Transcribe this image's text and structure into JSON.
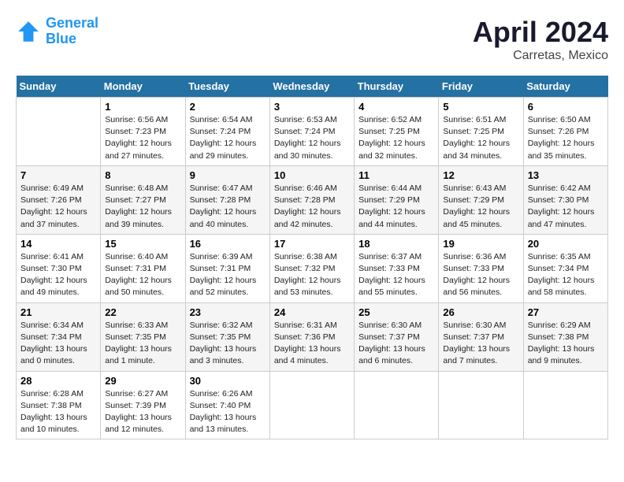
{
  "header": {
    "logo_line1": "General",
    "logo_line2": "Blue",
    "title": "April 2024",
    "subtitle": "Carretas, Mexico"
  },
  "days_of_week": [
    "Sunday",
    "Monday",
    "Tuesday",
    "Wednesday",
    "Thursday",
    "Friday",
    "Saturday"
  ],
  "weeks": [
    [
      {
        "num": "",
        "info": ""
      },
      {
        "num": "1",
        "info": "Sunrise: 6:56 AM\nSunset: 7:23 PM\nDaylight: 12 hours\nand 27 minutes."
      },
      {
        "num": "2",
        "info": "Sunrise: 6:54 AM\nSunset: 7:24 PM\nDaylight: 12 hours\nand 29 minutes."
      },
      {
        "num": "3",
        "info": "Sunrise: 6:53 AM\nSunset: 7:24 PM\nDaylight: 12 hours\nand 30 minutes."
      },
      {
        "num": "4",
        "info": "Sunrise: 6:52 AM\nSunset: 7:25 PM\nDaylight: 12 hours\nand 32 minutes."
      },
      {
        "num": "5",
        "info": "Sunrise: 6:51 AM\nSunset: 7:25 PM\nDaylight: 12 hours\nand 34 minutes."
      },
      {
        "num": "6",
        "info": "Sunrise: 6:50 AM\nSunset: 7:26 PM\nDaylight: 12 hours\nand 35 minutes."
      }
    ],
    [
      {
        "num": "7",
        "info": "Sunrise: 6:49 AM\nSunset: 7:26 PM\nDaylight: 12 hours\nand 37 minutes."
      },
      {
        "num": "8",
        "info": "Sunrise: 6:48 AM\nSunset: 7:27 PM\nDaylight: 12 hours\nand 39 minutes."
      },
      {
        "num": "9",
        "info": "Sunrise: 6:47 AM\nSunset: 7:28 PM\nDaylight: 12 hours\nand 40 minutes."
      },
      {
        "num": "10",
        "info": "Sunrise: 6:46 AM\nSunset: 7:28 PM\nDaylight: 12 hours\nand 42 minutes."
      },
      {
        "num": "11",
        "info": "Sunrise: 6:44 AM\nSunset: 7:29 PM\nDaylight: 12 hours\nand 44 minutes."
      },
      {
        "num": "12",
        "info": "Sunrise: 6:43 AM\nSunset: 7:29 PM\nDaylight: 12 hours\nand 45 minutes."
      },
      {
        "num": "13",
        "info": "Sunrise: 6:42 AM\nSunset: 7:30 PM\nDaylight: 12 hours\nand 47 minutes."
      }
    ],
    [
      {
        "num": "14",
        "info": "Sunrise: 6:41 AM\nSunset: 7:30 PM\nDaylight: 12 hours\nand 49 minutes."
      },
      {
        "num": "15",
        "info": "Sunrise: 6:40 AM\nSunset: 7:31 PM\nDaylight: 12 hours\nand 50 minutes."
      },
      {
        "num": "16",
        "info": "Sunrise: 6:39 AM\nSunset: 7:31 PM\nDaylight: 12 hours\nand 52 minutes."
      },
      {
        "num": "17",
        "info": "Sunrise: 6:38 AM\nSunset: 7:32 PM\nDaylight: 12 hours\nand 53 minutes."
      },
      {
        "num": "18",
        "info": "Sunrise: 6:37 AM\nSunset: 7:33 PM\nDaylight: 12 hours\nand 55 minutes."
      },
      {
        "num": "19",
        "info": "Sunrise: 6:36 AM\nSunset: 7:33 PM\nDaylight: 12 hours\nand 56 minutes."
      },
      {
        "num": "20",
        "info": "Sunrise: 6:35 AM\nSunset: 7:34 PM\nDaylight: 12 hours\nand 58 minutes."
      }
    ],
    [
      {
        "num": "21",
        "info": "Sunrise: 6:34 AM\nSunset: 7:34 PM\nDaylight: 13 hours\nand 0 minutes."
      },
      {
        "num": "22",
        "info": "Sunrise: 6:33 AM\nSunset: 7:35 PM\nDaylight: 13 hours\nand 1 minute."
      },
      {
        "num": "23",
        "info": "Sunrise: 6:32 AM\nSunset: 7:35 PM\nDaylight: 13 hours\nand 3 minutes."
      },
      {
        "num": "24",
        "info": "Sunrise: 6:31 AM\nSunset: 7:36 PM\nDaylight: 13 hours\nand 4 minutes."
      },
      {
        "num": "25",
        "info": "Sunrise: 6:30 AM\nSunset: 7:37 PM\nDaylight: 13 hours\nand 6 minutes."
      },
      {
        "num": "26",
        "info": "Sunrise: 6:30 AM\nSunset: 7:37 PM\nDaylight: 13 hours\nand 7 minutes."
      },
      {
        "num": "27",
        "info": "Sunrise: 6:29 AM\nSunset: 7:38 PM\nDaylight: 13 hours\nand 9 minutes."
      }
    ],
    [
      {
        "num": "28",
        "info": "Sunrise: 6:28 AM\nSunset: 7:38 PM\nDaylight: 13 hours\nand 10 minutes."
      },
      {
        "num": "29",
        "info": "Sunrise: 6:27 AM\nSunset: 7:39 PM\nDaylight: 13 hours\nand 12 minutes."
      },
      {
        "num": "30",
        "info": "Sunrise: 6:26 AM\nSunset: 7:40 PM\nDaylight: 13 hours\nand 13 minutes."
      },
      {
        "num": "",
        "info": ""
      },
      {
        "num": "",
        "info": ""
      },
      {
        "num": "",
        "info": ""
      },
      {
        "num": "",
        "info": ""
      }
    ]
  ]
}
